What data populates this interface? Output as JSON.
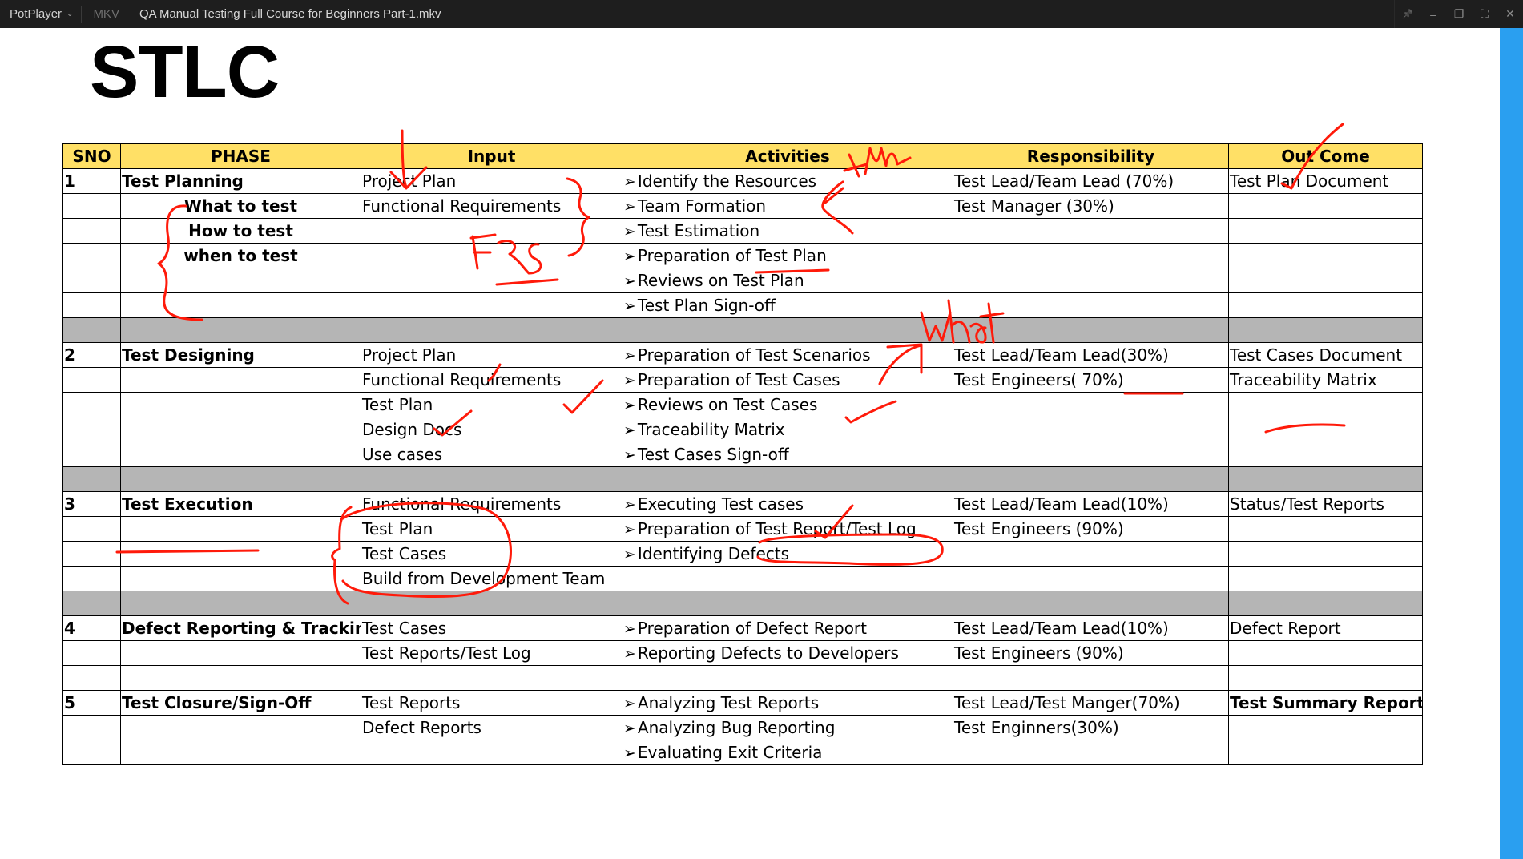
{
  "window": {
    "app_name": "PotPlayer",
    "format": "MKV",
    "file_title": "QA Manual Testing Full Course for Beginners Part-1.mkv",
    "controls": {
      "pin": "📌",
      "minimize": "–",
      "restore": "❐",
      "fullscreen": "⛶",
      "close": "✕"
    }
  },
  "slide": {
    "title": "STLC",
    "headers": [
      "SNO",
      "PHASE",
      "Input",
      "Activities",
      "Responsibility",
      "Out Come"
    ],
    "rows": [
      {
        "sno": "1",
        "phase": "Test Planning",
        "input": "Project Plan",
        "activity": "Identify the Resources",
        "resp": "Test Lead/Team Lead (70%)",
        "out": "Test Plan Document"
      },
      {
        "sno": "",
        "phase": "What to test",
        "input": "Functional Requirements",
        "activity": "Team Formation",
        "resp": "Test Manager (30%)",
        "out": ""
      },
      {
        "sno": "",
        "phase": "How to test",
        "input": "",
        "activity": "Test Estimation",
        "resp": "",
        "out": ""
      },
      {
        "sno": "",
        "phase": "when to test",
        "input": "",
        "activity": "Preparation of Test Plan",
        "resp": "",
        "out": ""
      },
      {
        "sno": "",
        "phase": "",
        "input": "",
        "activity": "Reviews on Test Plan",
        "resp": "",
        "out": ""
      },
      {
        "sno": "",
        "phase": "",
        "input": "",
        "activity": "Test Plan Sign-off",
        "resp": "",
        "out": ""
      },
      {
        "sno": "2",
        "phase": "Test Designing",
        "input": "Project Plan",
        "activity": "Preparation of Test Scenarios",
        "resp": "Test Lead/Team Lead(30%)",
        "out": "Test Cases Document"
      },
      {
        "sno": "",
        "phase": "",
        "input": "Functional Requirements",
        "activity": "Preparation of Test Cases",
        "resp": "Test Engineers( 70%)",
        "out": "Traceability Matrix"
      },
      {
        "sno": "",
        "phase": "",
        "input": "Test Plan",
        "activity": "Reviews on Test Cases",
        "resp": "",
        "out": ""
      },
      {
        "sno": "",
        "phase": "",
        "input": "Design Docs",
        "activity": "Traceability Matrix",
        "resp": "",
        "out": ""
      },
      {
        "sno": "",
        "phase": "",
        "input": "Use cases",
        "activity": "Test Cases Sign-off",
        "resp": "",
        "out": ""
      },
      {
        "sno": "3",
        "phase": "Test Execution",
        "input": "Functional Requirements",
        "activity": "Executing Test cases",
        "resp": "Test Lead/Team Lead(10%)",
        "out": "Status/Test Reports"
      },
      {
        "sno": "",
        "phase": "",
        "input": "Test Plan",
        "activity": "Preparation of Test Report/Test Log",
        "resp": "Test Engineers (90%)",
        "out": ""
      },
      {
        "sno": "",
        "phase": "",
        "input": "Test Cases",
        "activity": "Identifying Defects",
        "resp": "",
        "out": ""
      },
      {
        "sno": "",
        "phase": "",
        "input": "Build from Development Team",
        "activity": "",
        "resp": "",
        "out": ""
      },
      {
        "sno": "4",
        "phase": "Defect Reporting & Tracking",
        "input": "Test Cases",
        "activity": "Preparation of Defect Report",
        "resp": "Test Lead/Team Lead(10%)",
        "out": "Defect Report"
      },
      {
        "sno": "",
        "phase": "",
        "input": "Test Reports/Test Log",
        "activity": "Reporting Defects to Developers",
        "resp": "Test Engineers (90%)",
        "out": ""
      },
      {
        "sno": "5",
        "phase": "Test Closure/Sign-Off",
        "input": "Test Reports",
        "activity": "Analyzing Test Reports",
        "resp": "Test Lead/Test Manger(70%)",
        "out": "Test Summary Reports"
      },
      {
        "sno": "",
        "phase": "",
        "input": "Defect Reports",
        "activity": "Analyzing Bug Reporting",
        "resp": "Test Enginners(30%)",
        "out": ""
      },
      {
        "sno": "",
        "phase": "",
        "input": "",
        "activity": "Evaluating Exit Criteria",
        "resp": "",
        "out": ""
      }
    ],
    "bullet": "➢",
    "annotations": {
      "note_tm": "tm",
      "note_frs": "FRS",
      "note_what": "what"
    },
    "ink_color": "#ff1a0a"
  }
}
